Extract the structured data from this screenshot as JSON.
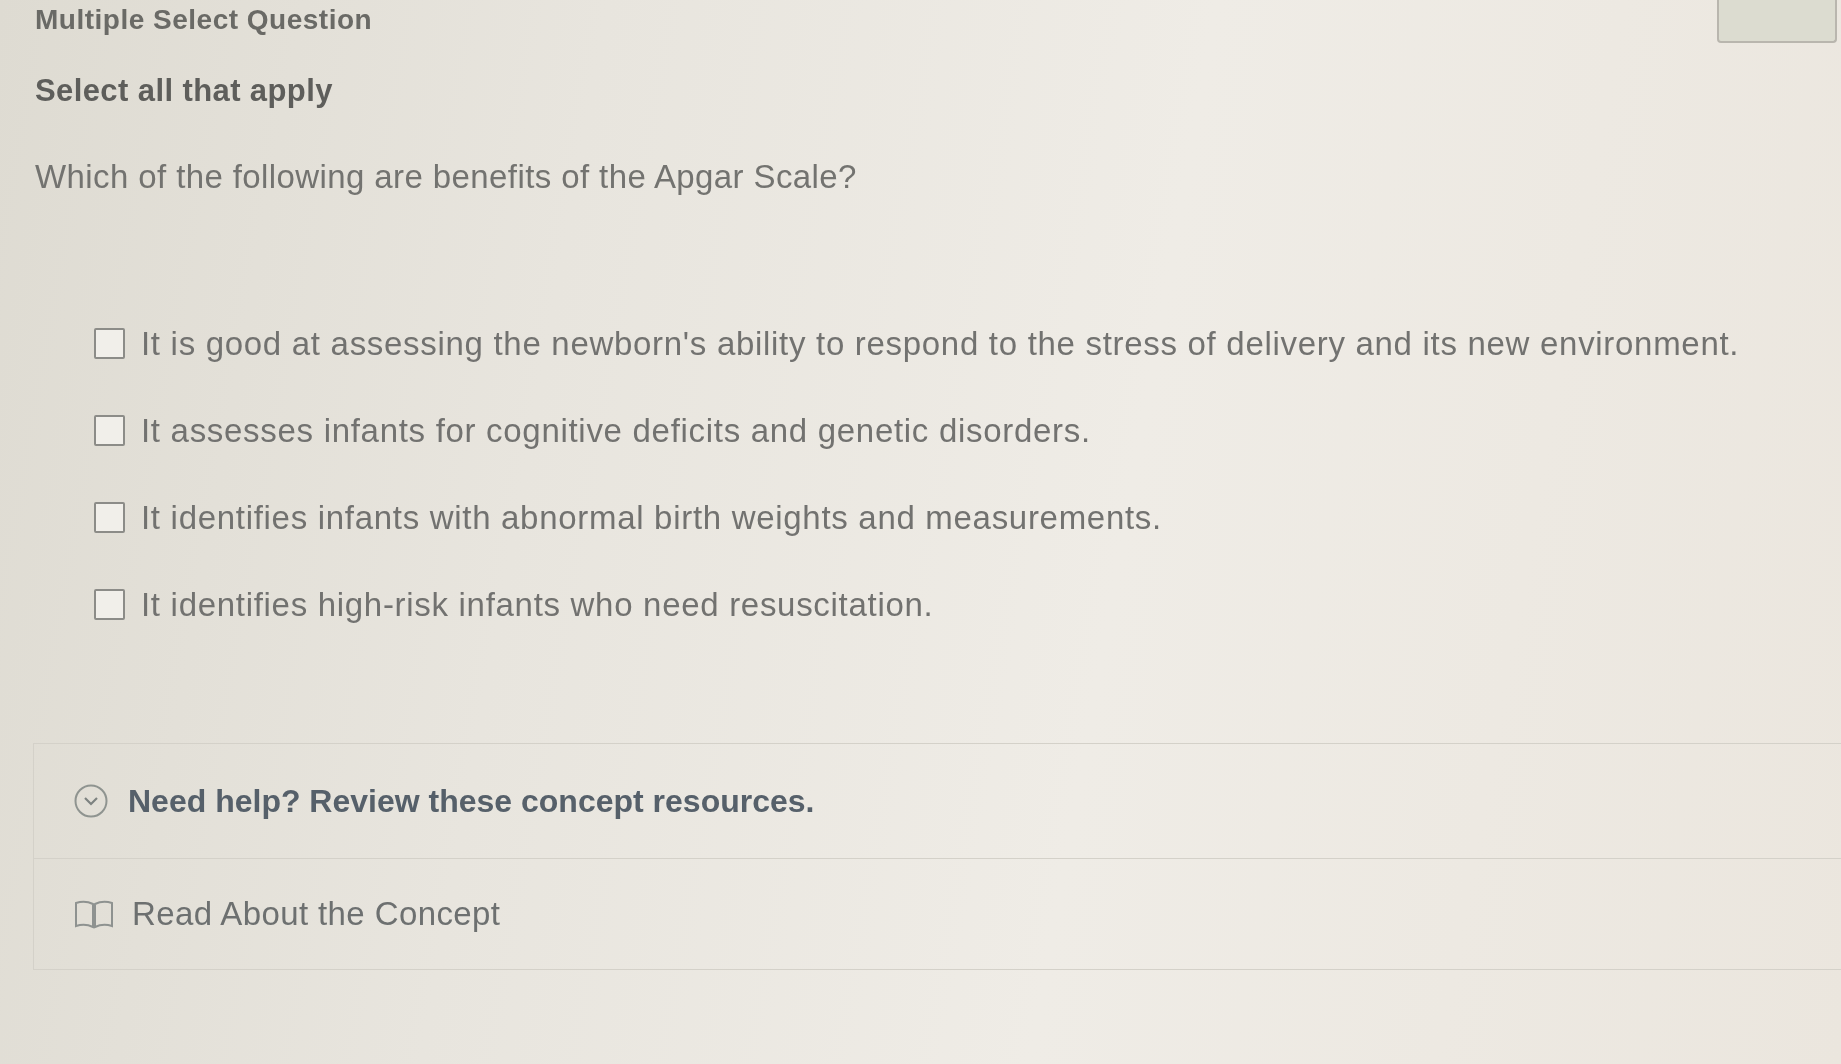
{
  "header": {
    "title": "Multiple Select Question"
  },
  "instruction": "Select all that apply",
  "question": "Which of the following are benefits of the Apgar Scale?",
  "options": [
    {
      "label": "It is good at assessing the newborn's ability to respond to the stress of delivery and its new environment.",
      "checked": false
    },
    {
      "label": "It assesses infants for cognitive deficits and genetic disorders.",
      "checked": false
    },
    {
      "label": "It identifies infants with abnormal birth weights and measurements.",
      "checked": false
    },
    {
      "label": "It identifies high-risk infants who need resuscitation.",
      "checked": false
    }
  ],
  "help": {
    "title": "Need help? Review these concept resources.",
    "expanded": true,
    "resources": [
      {
        "label": "Read About the Concept"
      }
    ]
  }
}
